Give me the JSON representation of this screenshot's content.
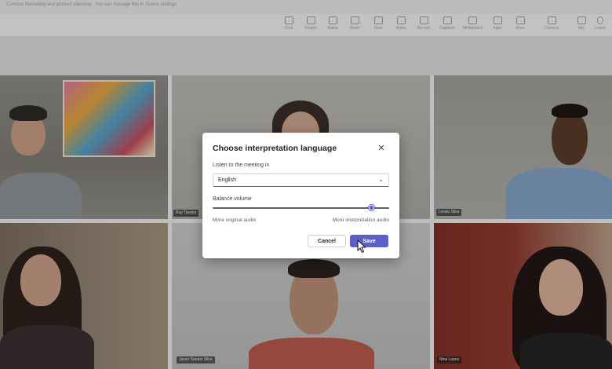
{
  "window": {
    "title": "Contoso Marketing and product planning  · You can manage this in Teams settings"
  },
  "toolbar": {
    "items": [
      {
        "label": "Chat",
        "icon": "chat-icon"
      },
      {
        "label": "People",
        "icon": "people-icon"
      },
      {
        "label": "Raise",
        "icon": "raise-hand-icon"
      },
      {
        "label": "React",
        "icon": "react-icon"
      },
      {
        "label": "View",
        "icon": "view-icon"
      },
      {
        "label": "Notes",
        "icon": "notes-icon"
      },
      {
        "label": "Record",
        "icon": "record-icon"
      },
      {
        "label": "Captions",
        "icon": "captions-icon"
      },
      {
        "label": "Whiteboard",
        "icon": "whiteboard-icon"
      },
      {
        "label": "Apps",
        "icon": "apps-icon"
      },
      {
        "label": "More",
        "icon": "more-icon"
      },
      {
        "label": "Camera",
        "icon": "camera-icon"
      },
      {
        "label": "Mic",
        "icon": "mic-icon"
      },
      {
        "label": "Leave",
        "icon": "leave-icon"
      }
    ]
  },
  "tiles": [
    {
      "name": ""
    },
    {
      "name": "Ray Tanaka"
    },
    {
      "name": "Lerato Silva"
    },
    {
      "name": ""
    },
    {
      "name": "Javier Santos Silva"
    },
    {
      "name": "Nina Lopez"
    }
  ],
  "dialog": {
    "title": "Choose interpretation language",
    "close_icon": "close-icon",
    "listen_label": "Listen to the meeting in",
    "language": "English",
    "balance_label": "Balance volume",
    "balance_fraction": 0.9,
    "left_label": "More original audio",
    "right_label": "More interpretation audio",
    "cancel_label": "Cancel",
    "save_label": "Save"
  },
  "colors": {
    "accent": "#5b5fc7",
    "dialog_bg": "#ffffff"
  }
}
